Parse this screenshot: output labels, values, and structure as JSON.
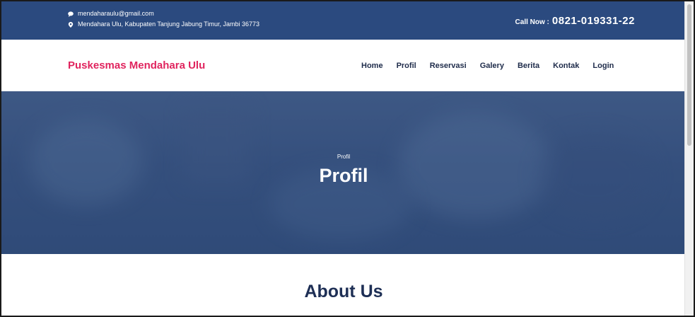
{
  "topbar": {
    "email": "mendaharaulu@gmail.com",
    "address": "Mendahara Ulu, Kabupaten Tanjung Jabung Timur, Jambi 36773",
    "call_label": "Call Now :",
    "call_number": "0821-019331-22",
    "icons": {
      "email": "chat-bubble-icon",
      "address": "map-pin-icon"
    }
  },
  "brand": {
    "name": "Puskesmas Mendahara Ulu",
    "color": "#e0245e"
  },
  "nav": {
    "items": [
      {
        "label": "Home"
      },
      {
        "label": "Profil"
      },
      {
        "label": "Reservasi"
      },
      {
        "label": "Galery"
      },
      {
        "label": "Berita"
      },
      {
        "label": "Kontak"
      },
      {
        "label": "Login"
      }
    ]
  },
  "hero": {
    "breadcrumb": "Profil",
    "title": "Profil"
  },
  "about": {
    "heading": "About Us"
  },
  "colors": {
    "topbar_bg": "#2b4a7f",
    "heading": "#1e2f55",
    "accent": "#e0245e"
  }
}
